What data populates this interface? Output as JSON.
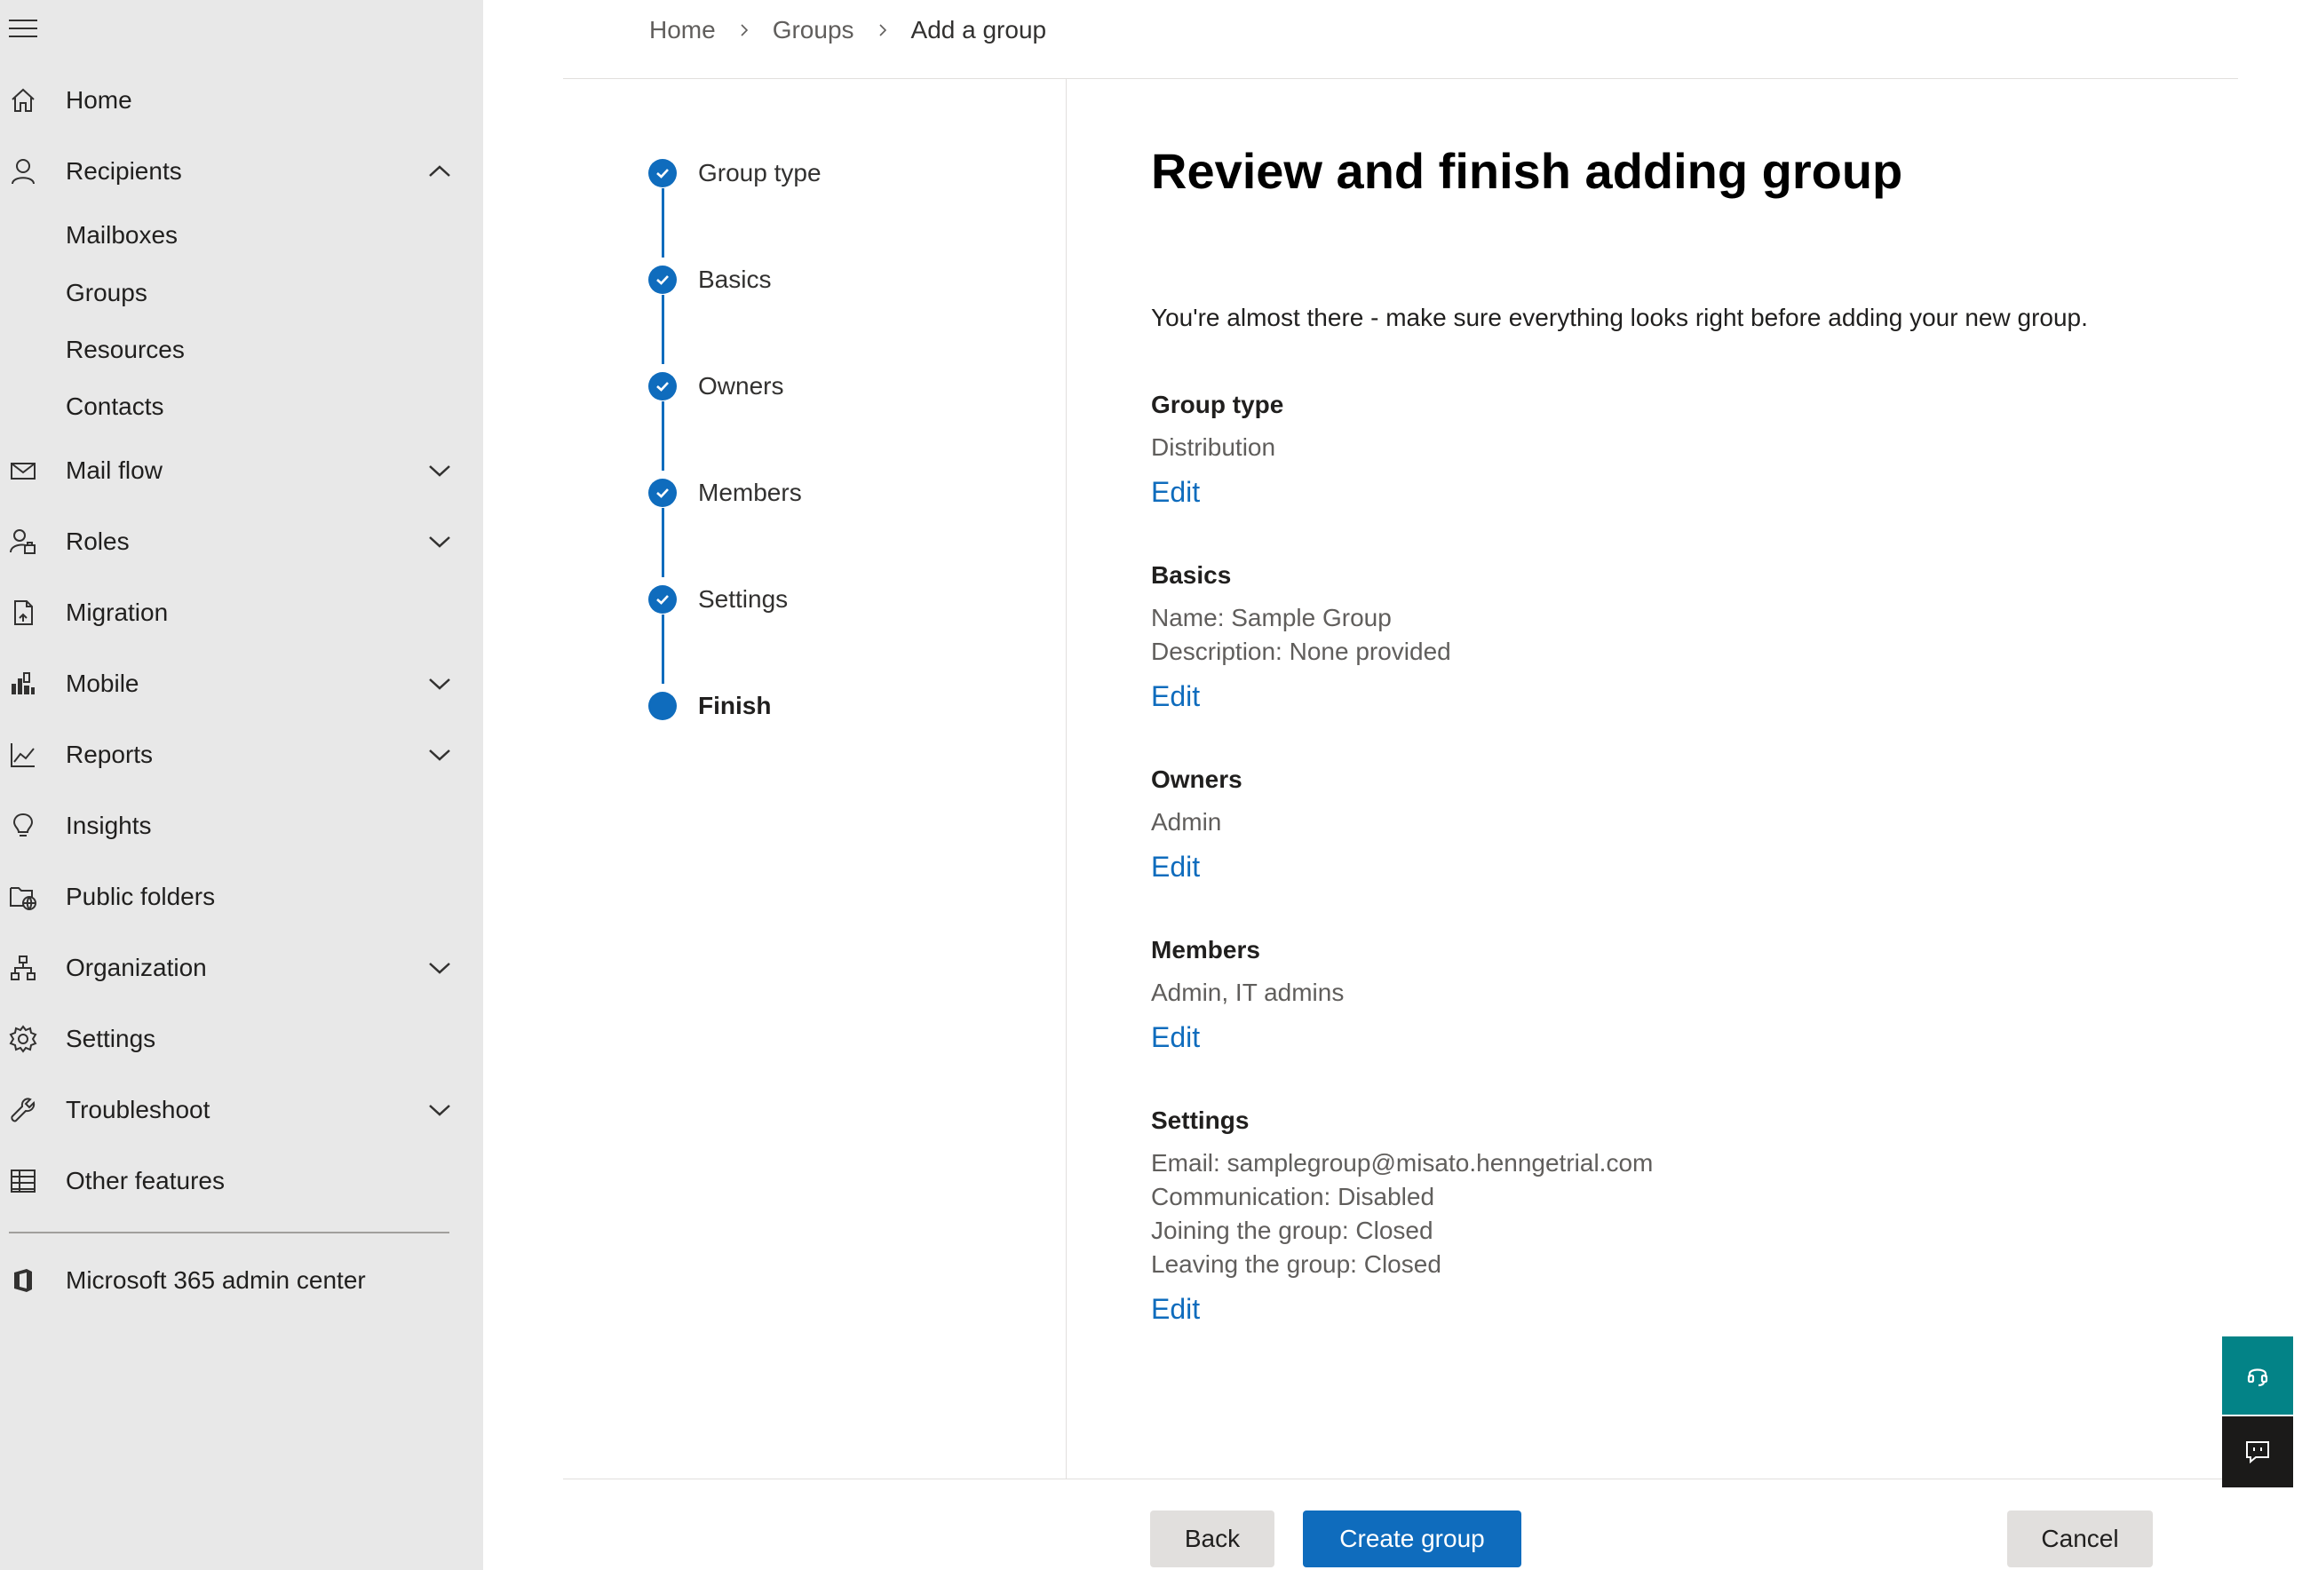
{
  "sidebar": {
    "items": [
      {
        "label": "Home",
        "icon": "home-icon"
      },
      {
        "label": "Recipients",
        "icon": "person-icon",
        "expanded": true,
        "children": [
          "Mailboxes",
          "Groups",
          "Resources",
          "Contacts"
        ]
      },
      {
        "label": "Mail flow",
        "icon": "mail-icon"
      },
      {
        "label": "Roles",
        "icon": "roles-icon"
      },
      {
        "label": "Migration",
        "icon": "migration-icon"
      },
      {
        "label": "Mobile",
        "icon": "mobile-icon"
      },
      {
        "label": "Reports",
        "icon": "reports-icon"
      },
      {
        "label": "Insights",
        "icon": "lightbulb-icon"
      },
      {
        "label": "Public folders",
        "icon": "public-folder-icon"
      },
      {
        "label": "Organization",
        "icon": "org-chart-icon"
      },
      {
        "label": "Settings",
        "icon": "gear-icon"
      },
      {
        "label": "Troubleshoot",
        "icon": "wrench-icon"
      },
      {
        "label": "Other features",
        "icon": "table-icon"
      }
    ],
    "admin_center": {
      "label": "Microsoft 365 admin center",
      "icon": "office-icon"
    }
  },
  "breadcrumb": [
    "Home",
    "Groups",
    "Add a group"
  ],
  "steps": [
    {
      "label": "Group type",
      "state": "done"
    },
    {
      "label": "Basics",
      "state": "done"
    },
    {
      "label": "Owners",
      "state": "done"
    },
    {
      "label": "Members",
      "state": "done"
    },
    {
      "label": "Settings",
      "state": "done"
    },
    {
      "label": "Finish",
      "state": "current"
    }
  ],
  "main": {
    "title": "Review and finish adding group",
    "intro": "You're almost there - make sure everything looks right before adding your new group.",
    "edit_label": "Edit",
    "sections": [
      {
        "title": "Group type",
        "lines": [
          "Distribution"
        ]
      },
      {
        "title": "Basics",
        "lines": [
          "Name: Sample Group",
          "Description: None provided"
        ]
      },
      {
        "title": "Owners",
        "lines": [
          "Admin"
        ]
      },
      {
        "title": "Members",
        "lines": [
          "Admin, IT admins"
        ]
      },
      {
        "title": "Settings",
        "lines": [
          "Email: samplegroup@misato.henngetrial.com",
          "Communication: Disabled",
          "Joining the group: Closed",
          "Leaving the group: Closed"
        ]
      }
    ]
  },
  "footer": {
    "back": "Back",
    "primary": "Create group",
    "cancel": "Cancel"
  },
  "colors": {
    "accent": "#0f6cbd",
    "sidebar_bg": "#e8e8e8",
    "help_bg": "#038387",
    "feedback_bg": "#1b1a19"
  }
}
